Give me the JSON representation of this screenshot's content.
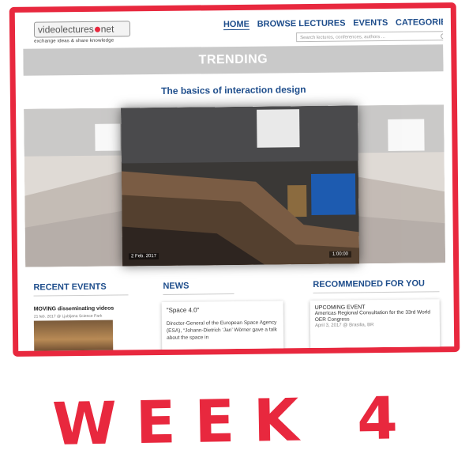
{
  "site": {
    "logo_text": "videolectures",
    "logo_suffix": "net",
    "tagline": "exchange ideas & share knowledge"
  },
  "nav": {
    "items": [
      "HOME",
      "BROWSE LECTURES",
      "EVENTS",
      "CATEGORIES"
    ]
  },
  "search": {
    "placeholder": "Search lectures, conferences, authors ..."
  },
  "trending": {
    "heading": "TRENDING",
    "video_title": "The basics of interaction design",
    "date": "2 Feb. 2017",
    "duration": "1:00:00"
  },
  "recent_events": {
    "heading": "RECENT EVENTS",
    "item_title": "MOVING disseminating videos",
    "item_meta": "21 feb. 2017 @ Ljubljana Science Park"
  },
  "news": {
    "heading": "NEWS",
    "card_title": "\"Space 4.0\"",
    "card_text": "Director-General of the European Space Agency (ESA), “Johann-Dietrich ‘Jan’ Wörner gave a talk about the space in"
  },
  "recommended": {
    "heading": "RECOMMENDED FOR YOU",
    "kicker": "UPCOMING EVENT",
    "text": "Americas Regional Consultation for the 33rd World OER Congress",
    "meta": "April 3, 2017 @ Brasilia, BR"
  },
  "caption": "WEEK 4",
  "colors": {
    "frame": "#e8283e",
    "nav_blue": "#1f4e8c",
    "trending_bar": "#c9c9c9"
  }
}
